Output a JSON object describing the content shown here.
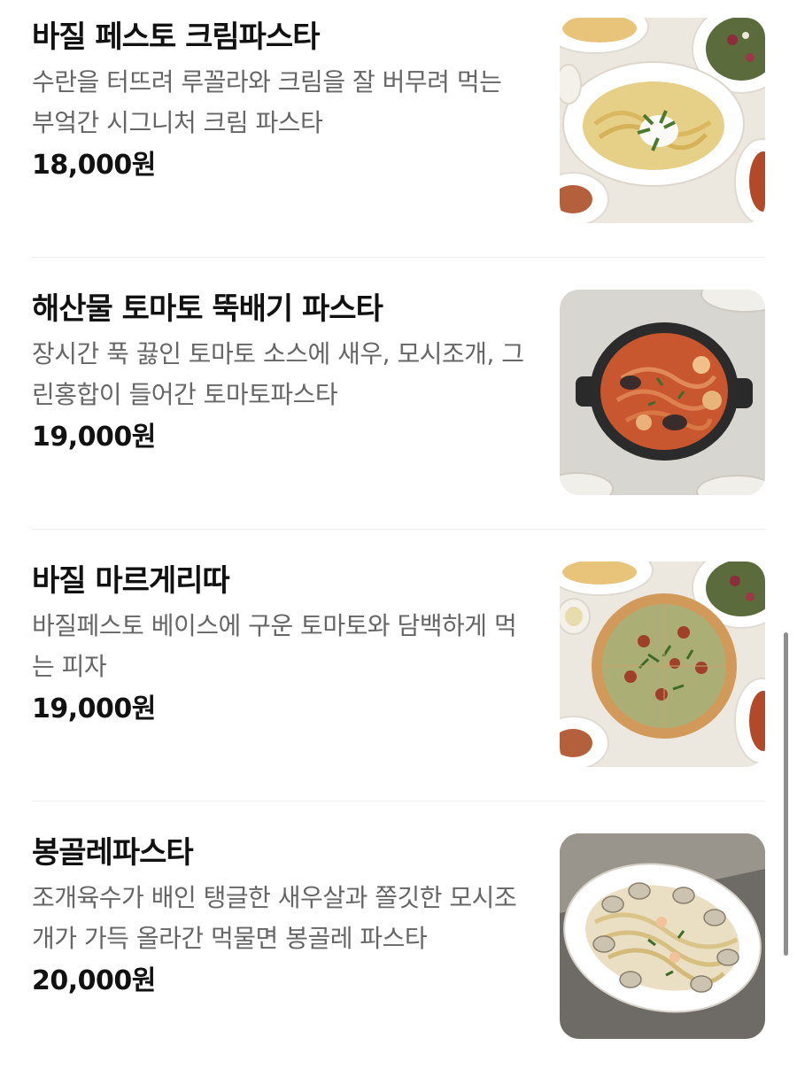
{
  "menu": {
    "items": [
      {
        "name": "바질 페스토 크림파스타",
        "description": "수란을 터뜨려 루꼴라와 크림을 잘 버무려 먹는 부엌간 시그니처 크림 파스타",
        "price": "18,000원",
        "image_alt": "basil pesto cream pasta dish"
      },
      {
        "name": "해산물 토마토 뚝배기 파스타",
        "description": "장시간 푹 끓인 토마토 소스에 새우, 모시조개, 그린홍합이 들어간 토마토파스타",
        "price": "19,000원",
        "image_alt": "seafood tomato pasta in cast iron pan"
      },
      {
        "name": "바질 마르게리따",
        "description": "바질페스토 베이스에 구운 토마토와 담백하게 먹는 피자",
        "price": "19,000원",
        "image_alt": "basil margherita pizza"
      },
      {
        "name": "봉골레파스타",
        "description": "조개육수가 배인 탱글한 새우살과 쫄깃한 모시조개가 가득 올라간 먹물면 봉골레 파스타",
        "price": "20,000원",
        "image_alt": "vongole pasta with clams"
      }
    ]
  }
}
